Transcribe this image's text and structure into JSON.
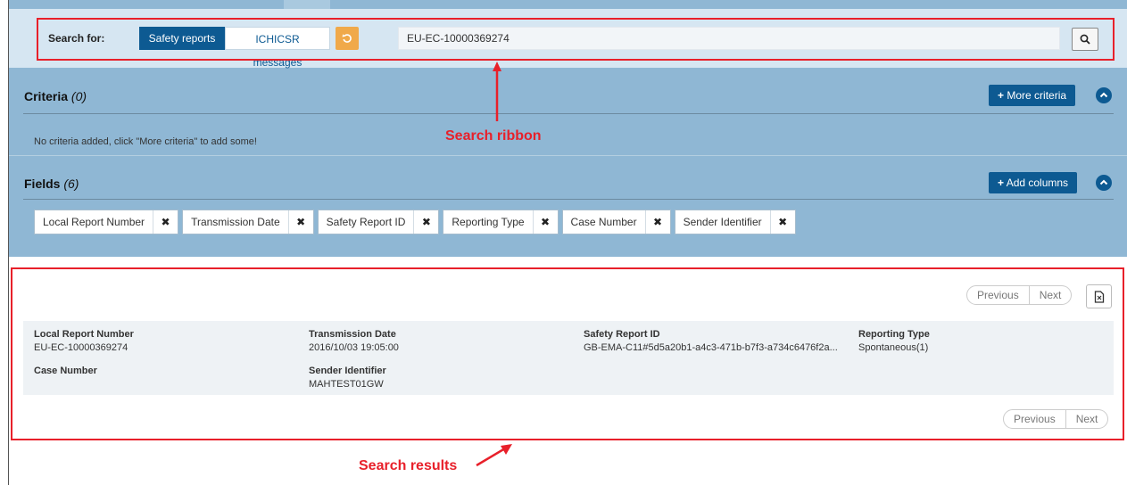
{
  "search_ribbon": {
    "label": "Search for:",
    "tabs": [
      {
        "label": "Safety reports",
        "active": true
      },
      {
        "label": "ICHICSR messages",
        "active": false
      }
    ],
    "reset_icon": "undo-icon",
    "query_value": "EU-EC-10000369274",
    "search_icon": "magnifier-icon"
  },
  "criteria": {
    "title": "Criteria",
    "count": "(0)",
    "more_button": "More criteria",
    "empty_note": "No criteria added, click \"More criteria\" to add some!"
  },
  "fields": {
    "title": "Fields",
    "count": "(6)",
    "add_button": "Add columns",
    "chips": [
      "Local Report Number",
      "Transmission Date",
      "Safety Report ID",
      "Reporting Type",
      "Case Number",
      "Sender Identifier"
    ]
  },
  "pagination": {
    "previous": "Previous",
    "next": "Next"
  },
  "results": {
    "columns": [
      {
        "header": "Local Report Number",
        "value": "EU-EC-10000369274"
      },
      {
        "header": "Transmission Date",
        "value": "2016/10/03 19:05:00"
      },
      {
        "header": "Safety Report ID",
        "value": "GB-EMA-C11#5d5a20b1-a4c3-471b-b7f3-a734c6476f2a..."
      },
      {
        "header": "Reporting Type",
        "value": "Spontaneous(1)"
      },
      {
        "header": "Case Number",
        "value": ""
      },
      {
        "header": "Sender Identifier",
        "value": "MAHTEST01GW"
      }
    ]
  },
  "annotations": {
    "ribbon_label": "Search ribbon",
    "results_label": "Search results"
  },
  "colors": {
    "accent_blue": "#0d5a92",
    "panel_blue": "#8fb7d4",
    "reset_orange": "#f0a94a",
    "annotation_red": "#e8202a"
  }
}
